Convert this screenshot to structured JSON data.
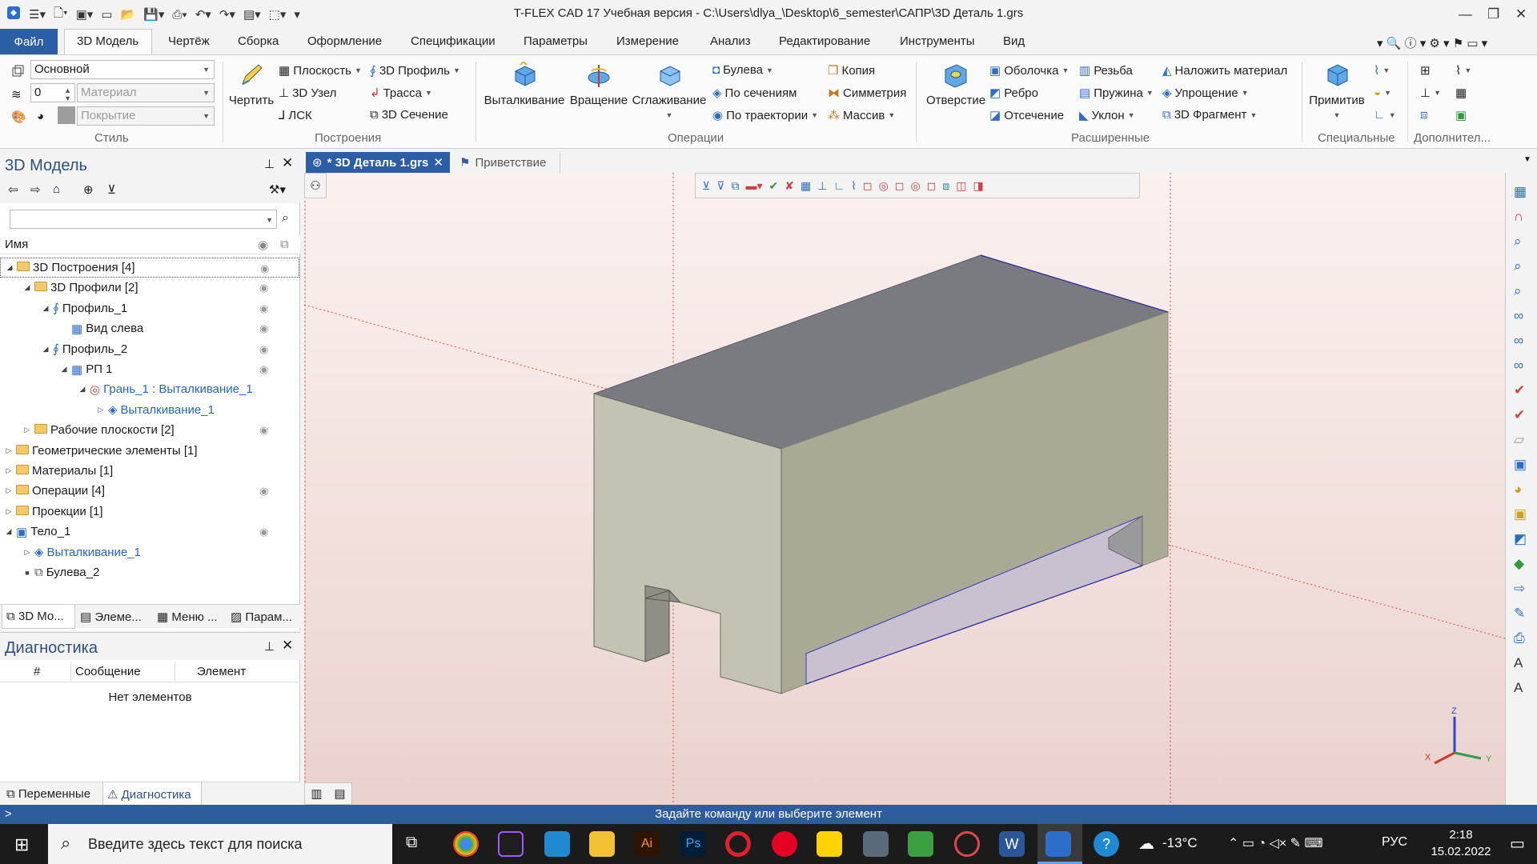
{
  "window": {
    "title": "T-FLEX CAD 17 Учебная версия - C:\\Users\\dlya_\\Desktop\\6_semester\\САПР\\3D Деталь 1.grs"
  },
  "ribbon_tabs": [
    "Файл",
    "3D Модель",
    "Чертёж",
    "Сборка",
    "Оформление",
    "Спецификации",
    "Параметры",
    "Измерение",
    "Анализ",
    "Редактирование",
    "Инструменты",
    "Вид"
  ],
  "style_group": {
    "layer_value": "Основной",
    "level_value": "0",
    "material_placeholder": "Материал",
    "coating_placeholder": "Покрытие",
    "label": "Стиль"
  },
  "build_group": {
    "draw": "Чертить",
    "plane": "Плоскость",
    "node3d": "3D Узел",
    "lcs": "ЛСК",
    "profile3d": "3D Профиль",
    "path": "Трасса",
    "section3d": "3D Сечение",
    "label": "Построения"
  },
  "ops_group": {
    "extrude": "Выталкивание",
    "revolve": "Вращение",
    "smooth": "Сглаживание",
    "boolean": "Булева",
    "by_sections": "По сечениям",
    "by_path": "По траектории",
    "copy": "Копия",
    "symmetry": "Симметрия",
    "array": "Массив",
    "label": "Операции"
  },
  "ext_group": {
    "hole": "Отверстие",
    "shell": "Оболочка",
    "rib": "Ребро",
    "cut": "Отсечение",
    "thread": "Резьба",
    "spring": "Пружина",
    "slope": "Уклон",
    "apply_material": "Наложить материал",
    "simplify": "Упрощение",
    "fragment3d": "3D Фрагмент",
    "label": "Расширенные"
  },
  "special_group": {
    "primitives": "Примитив",
    "label": "Специальные"
  },
  "extra_group": {
    "label": "Дополнител..."
  },
  "model_panel": {
    "title": "3D Модель",
    "column_name": "Имя",
    "tree": [
      {
        "label": "3D Построения [4]",
        "level": 0,
        "toggle": "◢",
        "icon": "folder",
        "link": false,
        "eye": true
      },
      {
        "label": "3D Профили [2]",
        "level": 1,
        "toggle": "◢",
        "icon": "folder",
        "link": false,
        "eye": true
      },
      {
        "label": "Профиль_1",
        "level": 2,
        "toggle": "◢",
        "icon": "profile",
        "link": false,
        "eye": true
      },
      {
        "label": "Вид слева",
        "level": 3,
        "toggle": "",
        "icon": "plane",
        "link": false,
        "eye": true
      },
      {
        "label": "Профиль_2",
        "level": 2,
        "toggle": "◢",
        "icon": "profile",
        "link": false,
        "eye": true
      },
      {
        "label": "РП 1",
        "level": 3,
        "toggle": "◢",
        "icon": "plane",
        "link": false,
        "eye": true
      },
      {
        "label": "Грань_1 : Выталкивание_1",
        "level": 4,
        "toggle": "◢",
        "icon": "face",
        "link": true,
        "eye": false
      },
      {
        "label": "Выталкивание_1",
        "level": 5,
        "toggle": "▷",
        "icon": "extrude",
        "link": true,
        "eye": false
      },
      {
        "label": "Рабочие плоскости [2]",
        "level": 1,
        "toggle": "▷",
        "icon": "folder",
        "link": false,
        "eye": true
      },
      {
        "label": "Геометрические элементы [1]",
        "level": 0,
        "toggle": "▷",
        "icon": "folder",
        "link": false,
        "eye": false
      },
      {
        "label": "Материалы [1]",
        "level": 0,
        "toggle": "▷",
        "icon": "folder",
        "link": false,
        "eye": false
      },
      {
        "label": "Операции [4]",
        "level": 0,
        "toggle": "▷",
        "icon": "folder",
        "link": false,
        "eye": true
      },
      {
        "label": "Проекции [1]",
        "level": 0,
        "toggle": "▷",
        "icon": "folder",
        "link": false,
        "eye": false
      },
      {
        "label": "Тело_1",
        "level": 0,
        "toggle": "◢",
        "icon": "body",
        "link": false,
        "eye": true
      },
      {
        "label": "Выталкивание_1",
        "level": 1,
        "toggle": "▷",
        "icon": "extrude",
        "link": true,
        "eye": false
      },
      {
        "label": "Булева_2",
        "level": 1,
        "toggle": "■",
        "icon": "bool",
        "link": false,
        "eye": false
      }
    ],
    "bottom_tabs": [
      "3D Мо...",
      "Элеме...",
      "Меню ...",
      "Парам..."
    ]
  },
  "diag_panel": {
    "title": "Диагностика",
    "col_num": "#",
    "col_message": "Сообщение",
    "col_element": "Элемент",
    "empty": "Нет элементов",
    "bottom_tabs": [
      "Переменные",
      "Диагностика"
    ]
  },
  "doc_tabs": [
    {
      "label": "* 3D Деталь 1.grs",
      "active": true
    },
    {
      "label": "Приветствие",
      "active": false
    }
  ],
  "statusbar": {
    "prompt": "Задайте команду или выберите элемент",
    "prompt_prefix": ">"
  },
  "taskbar": {
    "search_placeholder": "Введите здесь текст для поиска",
    "weather": "-13°C",
    "lang": "РУС",
    "time": "2:18",
    "date": "15.02.2022"
  },
  "colors": {
    "accent": "#2c5ea8",
    "statusbar": "#2d5d9f",
    "link": "#2266cc",
    "model_top": "#7a7b80",
    "model_side": "#a9a994",
    "model_front": "#c3c3b4"
  }
}
